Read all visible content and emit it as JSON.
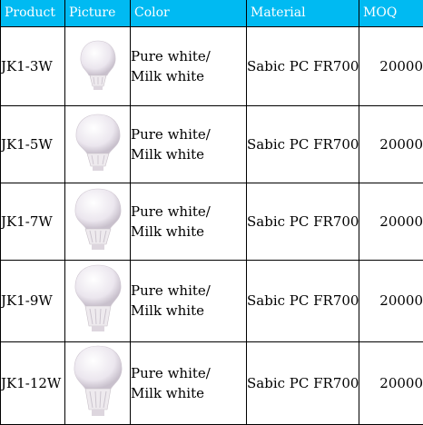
{
  "header": {
    "product": "Product",
    "picture": "Picture",
    "color": "Color",
    "material": "Material",
    "moq": "MOQ"
  },
  "rows": [
    {
      "product": "JK1-3W",
      "picture": "bulb-icon",
      "color_line1": "Pure white/",
      "color_line2": "Milk white",
      "material": "Sabic PC FR700",
      "moq": "20000"
    },
    {
      "product": "JK1-5W",
      "picture": "bulb-icon",
      "color_line1": "Pure white/",
      "color_line2": "Milk white",
      "material": "Sabic PC FR700",
      "moq": "20000"
    },
    {
      "product": "JK1-7W",
      "picture": "bulb-icon",
      "color_line1": "Pure white/",
      "color_line2": "Milk white",
      "material": "Sabic PC FR700",
      "moq": "20000"
    },
    {
      "product": "JK1-9W",
      "picture": "bulb-icon",
      "color_line1": "Pure white/",
      "color_line2": "Milk white",
      "material": "Sabic PC FR700",
      "moq": "20000"
    },
    {
      "product": "JK1-12W",
      "picture": "bulb-icon",
      "color_line1": "Pure white/",
      "color_line2": "Milk white",
      "material": "Sabic PC FR700",
      "moq": "20000"
    }
  ],
  "colors": {
    "header_bg": "#00baf2",
    "header_text": "#ffffff",
    "border": "#000000"
  }
}
